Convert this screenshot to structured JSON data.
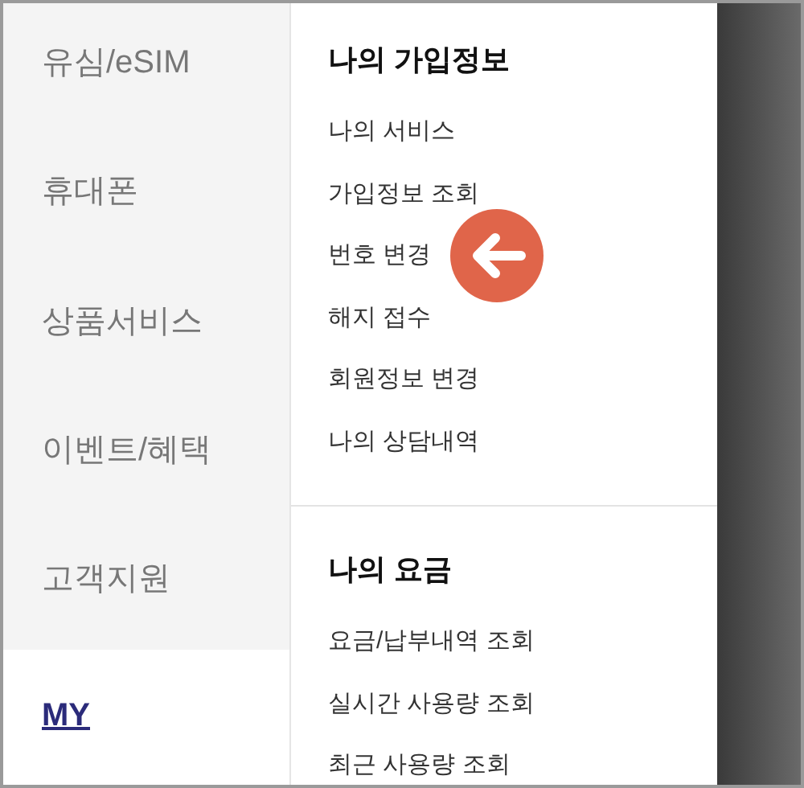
{
  "categories": [
    {
      "label": "유심/eSIM",
      "selected": false
    },
    {
      "label": "휴대폰",
      "selected": false
    },
    {
      "label": "상품서비스",
      "selected": false
    },
    {
      "label": "이벤트/혜택",
      "selected": false
    },
    {
      "label": "고객지원",
      "selected": false
    },
    {
      "label": "MY",
      "selected": true
    }
  ],
  "sections": [
    {
      "title": "나의 가입정보",
      "links": [
        {
          "label": "나의 서비스",
          "pointed": false
        },
        {
          "label": "가입정보 조회",
          "pointed": false
        },
        {
          "label": "번호 변경",
          "pointed": true
        },
        {
          "label": "해지 접수",
          "pointed": false
        },
        {
          "label": "회원정보 변경",
          "pointed": false
        },
        {
          "label": "나의 상담내역",
          "pointed": false
        }
      ]
    },
    {
      "title": "나의 요금",
      "links": [
        {
          "label": "요금/납부내역 조회",
          "pointed": false
        },
        {
          "label": "실시간 사용량 조회",
          "pointed": false
        },
        {
          "label": "최근 사용량 조회",
          "pointed": false
        }
      ]
    }
  ]
}
